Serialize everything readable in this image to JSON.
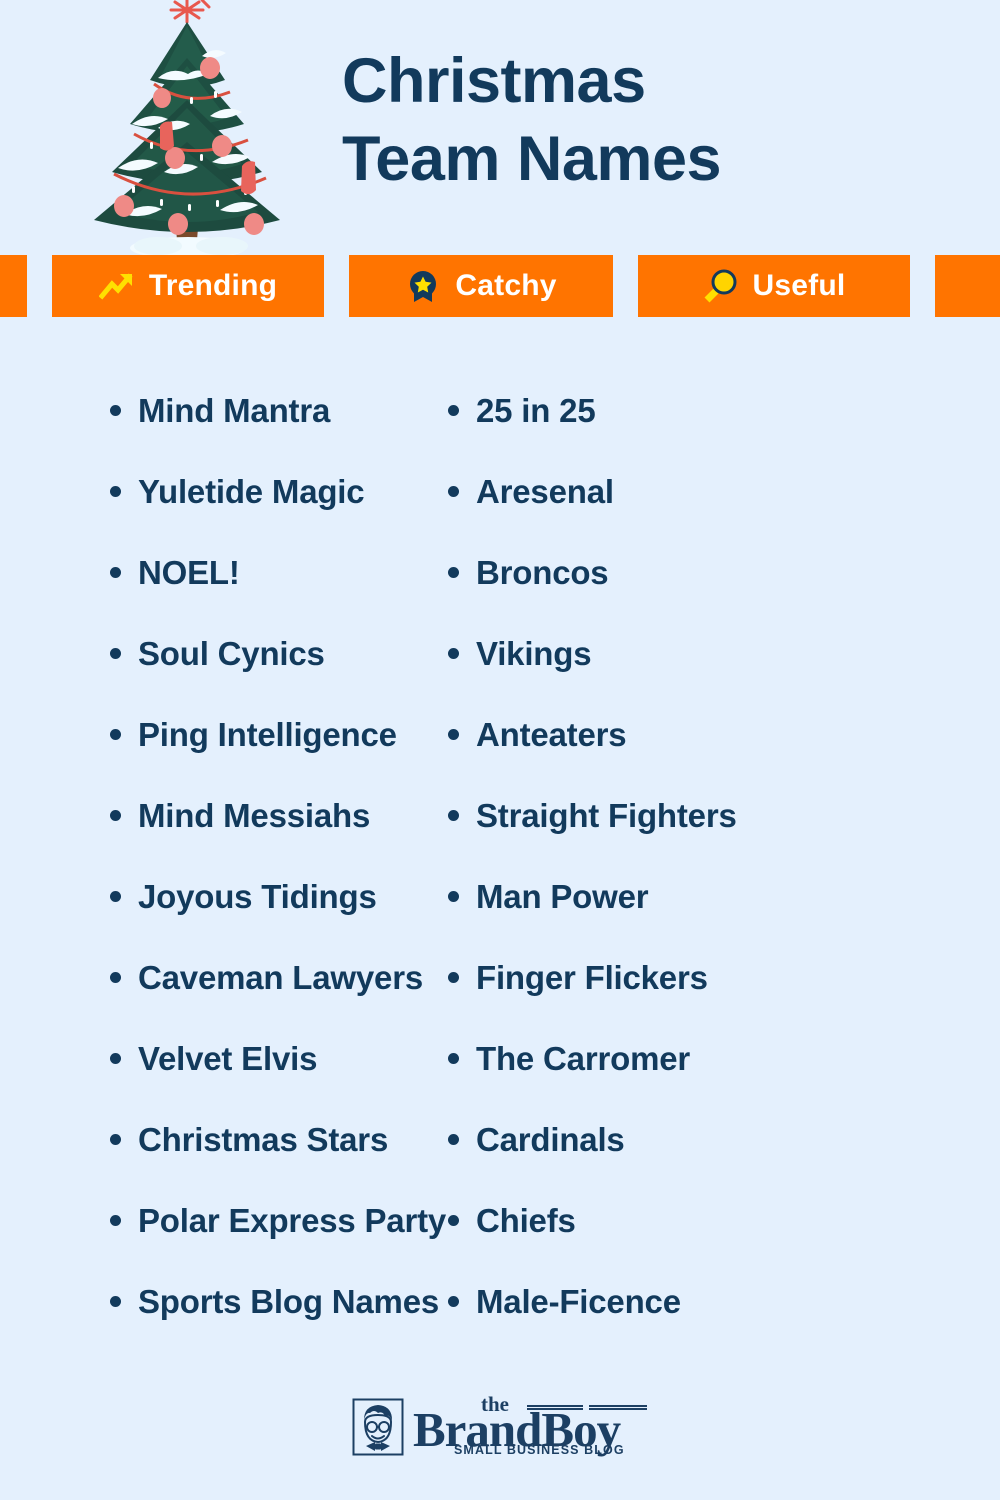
{
  "theme": {
    "background": "#e4f0fd",
    "navy": "#123a5c",
    "orange": "#ff7400",
    "yellow": "#ffd60a",
    "white": "#ffffff",
    "tree_green": "#1c4f42",
    "tree_trunk": "#7a4a2b",
    "ornament_pink": "#ef8a86",
    "garland_red": "#d9503f"
  },
  "header": {
    "title_line1": "Christmas",
    "title_line2": "Team Names",
    "tree_icon": "christmas-tree-icon"
  },
  "badges": [
    {
      "label": "Trending",
      "icon": "trending-up-icon"
    },
    {
      "label": "Catchy",
      "icon": "award-star-icon"
    },
    {
      "label": "Useful",
      "icon": "magnifier-icon"
    }
  ],
  "lists": {
    "left_column": [
      "Mind Mantra",
      "Yuletide Magic",
      "NOEL!",
      "Soul Cynics",
      "Ping Intelligence",
      "Mind Messiahs",
      "Joyous Tidings",
      "Caveman Lawyers",
      "Velvet Elvis",
      "Christmas Stars",
      "Polar Express Party",
      "Sports Blog Names"
    ],
    "right_column": [
      "25 in 25",
      "Aresenal",
      "Broncos",
      "Vikings",
      "Anteaters",
      "Straight Fighters",
      "Man Power",
      "Finger Flickers",
      "The Carromer",
      "Cardinals",
      "Chiefs",
      "Male-Ficence"
    ]
  },
  "footer": {
    "logo_the": "the",
    "logo_name": "BrandBoy",
    "logo_tagline": "SMALL BUSINESS BLOG",
    "logo_mark_icon": "boy-face-icon"
  }
}
